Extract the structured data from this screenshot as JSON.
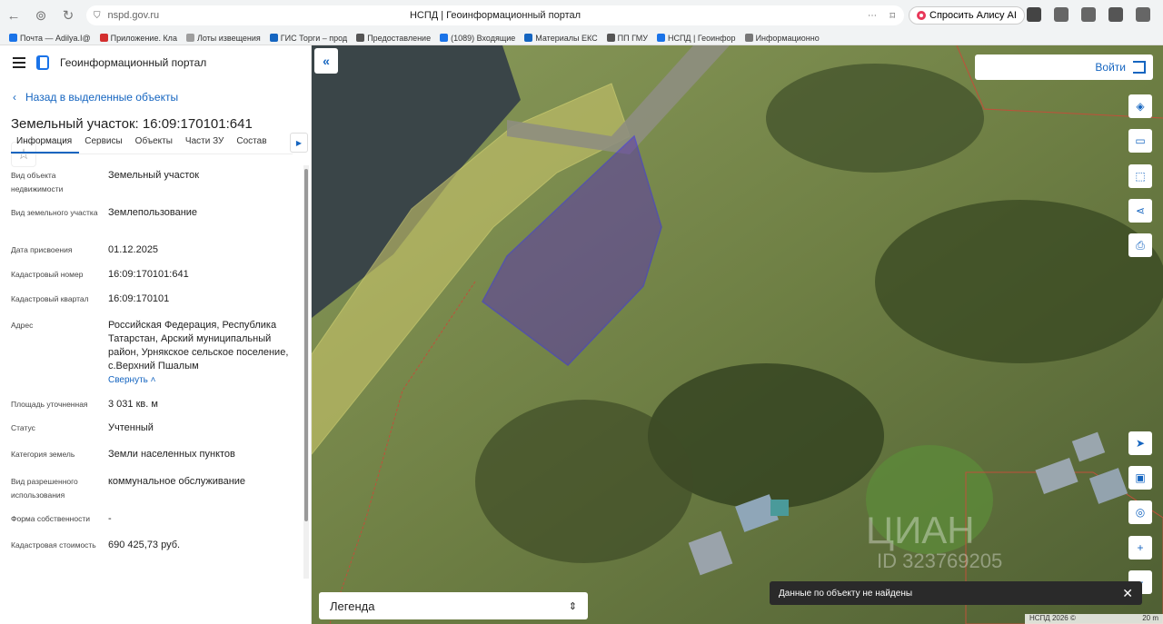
{
  "browser": {
    "url": "nspd.gov.ru",
    "title": "НСПД | Геоинформационный портал",
    "alice_label": "Спросить Алису AI"
  },
  "bookmarks": [
    {
      "label": "Почта — Adilya.I@",
      "color": "#1a73e8"
    },
    {
      "label": "Приложение. Кла",
      "color": "#d32f2f"
    },
    {
      "label": "Лоты извещения",
      "color": "#9e9e9e"
    },
    {
      "label": "ГИС Торги – прод",
      "color": "#1565c0"
    },
    {
      "label": "Предоставление",
      "color": "#555"
    },
    {
      "label": "(1089) Входящие",
      "color": "#1a73e8"
    },
    {
      "label": "Материалы ЕКС",
      "color": "#1565c0"
    },
    {
      "label": "ПП ГМУ",
      "color": "#555"
    },
    {
      "label": "НСПД | Геоинфор",
      "color": "#1a73e8"
    },
    {
      "label": "Информационно",
      "color": "#777"
    }
  ],
  "sidebar": {
    "app_title": "Геоинформационный портал",
    "back_label": "Назад в выделенные объекты",
    "object_title": "Земельный участок: 16:09:170101:641",
    "tabs": [
      "Информация",
      "Сервисы",
      "Объекты",
      "Части ЗУ",
      "Состав"
    ],
    "collapse_label": "Свернуть",
    "properties": [
      {
        "label": "Вид объекта недвижимости",
        "value": "Земельный участок"
      },
      {
        "label": "Вид земельного участка",
        "value": "Землепользование"
      },
      {
        "label": "Дата присвоения",
        "value": "01.12.2025"
      },
      {
        "label": "Кадастровый номер",
        "value": "16:09:170101:641"
      },
      {
        "label": "Кадастровый квартал",
        "value": "16:09:170101"
      },
      {
        "label": "Адрес",
        "value": "Российская Федерация, Республика Татарстан, Арский муниципальный район, Урнякское сельское поселение, с.Верхний Пшалым"
      },
      {
        "label": "Площадь уточненная",
        "value": "3 031 кв. м"
      },
      {
        "label": "Статус",
        "value": "Учтенный"
      },
      {
        "label": "Категория земель",
        "value": "Земли населенных пунктов"
      },
      {
        "label": "Вид разрешенного использования",
        "value": "коммунальное обслуживание"
      },
      {
        "label": "Форма собственности",
        "value": "-"
      },
      {
        "label": "Кадастровая стоимость",
        "value": "690 425,73 руб."
      }
    ]
  },
  "map": {
    "login_label": "Войти",
    "legend_label": "Легенда",
    "toast_text": "Данные по объекту не найдены",
    "copyright": "НСПД 2026 ©",
    "scale": "20 m",
    "watermark": "ЦИАН",
    "watermark_id": "ID 323769205"
  }
}
